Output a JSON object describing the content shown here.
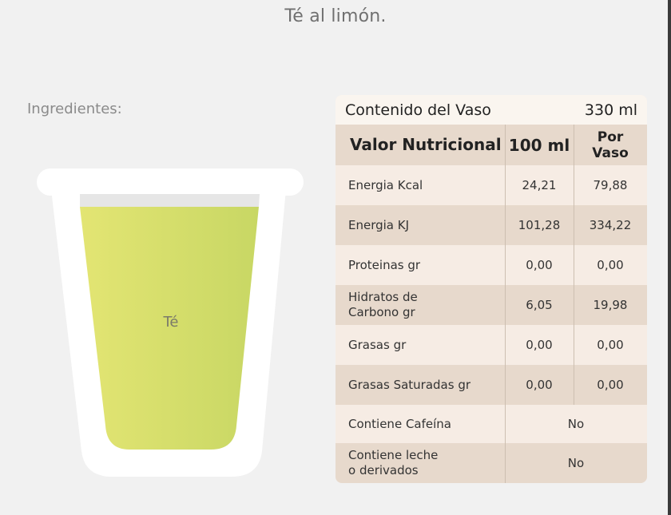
{
  "title": "Té al limón.",
  "ingredients_label": "Ingredientes:",
  "glass": {
    "liquid_label": "Té",
    "liquid_colors": [
      "#e3e573",
      "#c8d764"
    ],
    "glass_color": "#ffffff"
  },
  "table": {
    "contenido_label": "Contenido del Vaso",
    "contenido_value": "330 ml",
    "headers": {
      "nutrient": "Valor Nutricional",
      "per100": "100 ml",
      "per_glass_line1": "Por",
      "per_glass_line2": "Vaso"
    },
    "rows": [
      {
        "label": "Energia Kcal",
        "per100": "24,21",
        "per_glass": "79,88"
      },
      {
        "label": "Energia KJ",
        "per100": "101,28",
        "per_glass": "334,22"
      },
      {
        "label": "Proteinas gr",
        "per100": "0,00",
        "per_glass": "0,00"
      },
      {
        "label_line1": "Hidratos de",
        "label_line2": "Carbono gr",
        "per100": "6,05",
        "per_glass": "19,98"
      },
      {
        "label": "Grasas gr",
        "per100": "0,00",
        "per_glass": "0,00"
      },
      {
        "label": "Grasas Saturadas gr",
        "per100": "0,00",
        "per_glass": "0,00"
      },
      {
        "label": "Contiene Cafeína",
        "value": "No"
      },
      {
        "label_line1": "Contiene leche",
        "label_line2": "o derivados",
        "value": "No"
      }
    ]
  }
}
